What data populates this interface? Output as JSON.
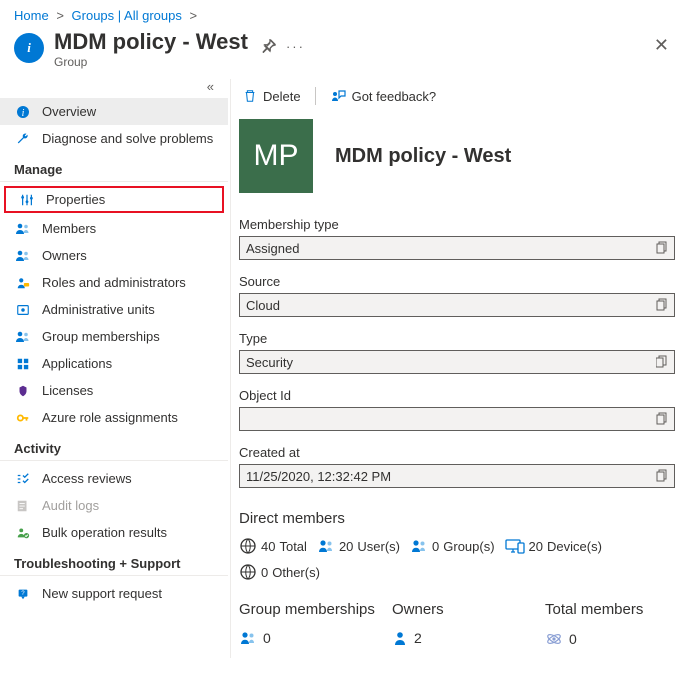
{
  "breadcrumb": {
    "home": "Home",
    "second": "Groups | All groups"
  },
  "header": {
    "title": "MDM policy - West",
    "subtitle": "Group"
  },
  "sidebar": {
    "collapse_glyph": "«",
    "overview": "Overview",
    "diagnose": "Diagnose and solve problems",
    "sect_manage": "Manage",
    "properties": "Properties",
    "members": "Members",
    "owners": "Owners",
    "roles": "Roles and administrators",
    "admin_units": "Administrative units",
    "group_memberships": "Group memberships",
    "applications": "Applications",
    "licenses": "Licenses",
    "azure_roles": "Azure role assignments",
    "sect_activity": "Activity",
    "access_reviews": "Access reviews",
    "audit_logs": "Audit logs",
    "bulk_results": "Bulk operation results",
    "sect_trouble": "Troubleshooting + Support",
    "new_support": "New support request"
  },
  "cmd": {
    "delete": "Delete",
    "feedback": "Got feedback?"
  },
  "group": {
    "avatar_initials": "MP",
    "name": "MDM policy - West"
  },
  "fields": {
    "membership_type": {
      "label": "Membership type",
      "value": "Assigned"
    },
    "source": {
      "label": "Source",
      "value": "Cloud"
    },
    "type": {
      "label": "Type",
      "value": "Security"
    },
    "object_id": {
      "label": "Object Id",
      "value": ""
    },
    "created_at": {
      "label": "Created at",
      "value": "11/25/2020, 12:32:42 PM"
    }
  },
  "direct_members": {
    "title": "Direct members",
    "total": {
      "n": "40",
      "label": "Total"
    },
    "users": {
      "n": "20",
      "label": "User(s)"
    },
    "groups": {
      "n": "0",
      "label": "Group(s)"
    },
    "devices": {
      "n": "20",
      "label": "Device(s)"
    },
    "others": {
      "n": "0",
      "label": "Other(s)"
    }
  },
  "summary": {
    "group_memberships": {
      "label": "Group memberships",
      "value": "0"
    },
    "owners": {
      "label": "Owners",
      "value": "2"
    },
    "total_members": {
      "label": "Total members",
      "value": "0"
    }
  }
}
